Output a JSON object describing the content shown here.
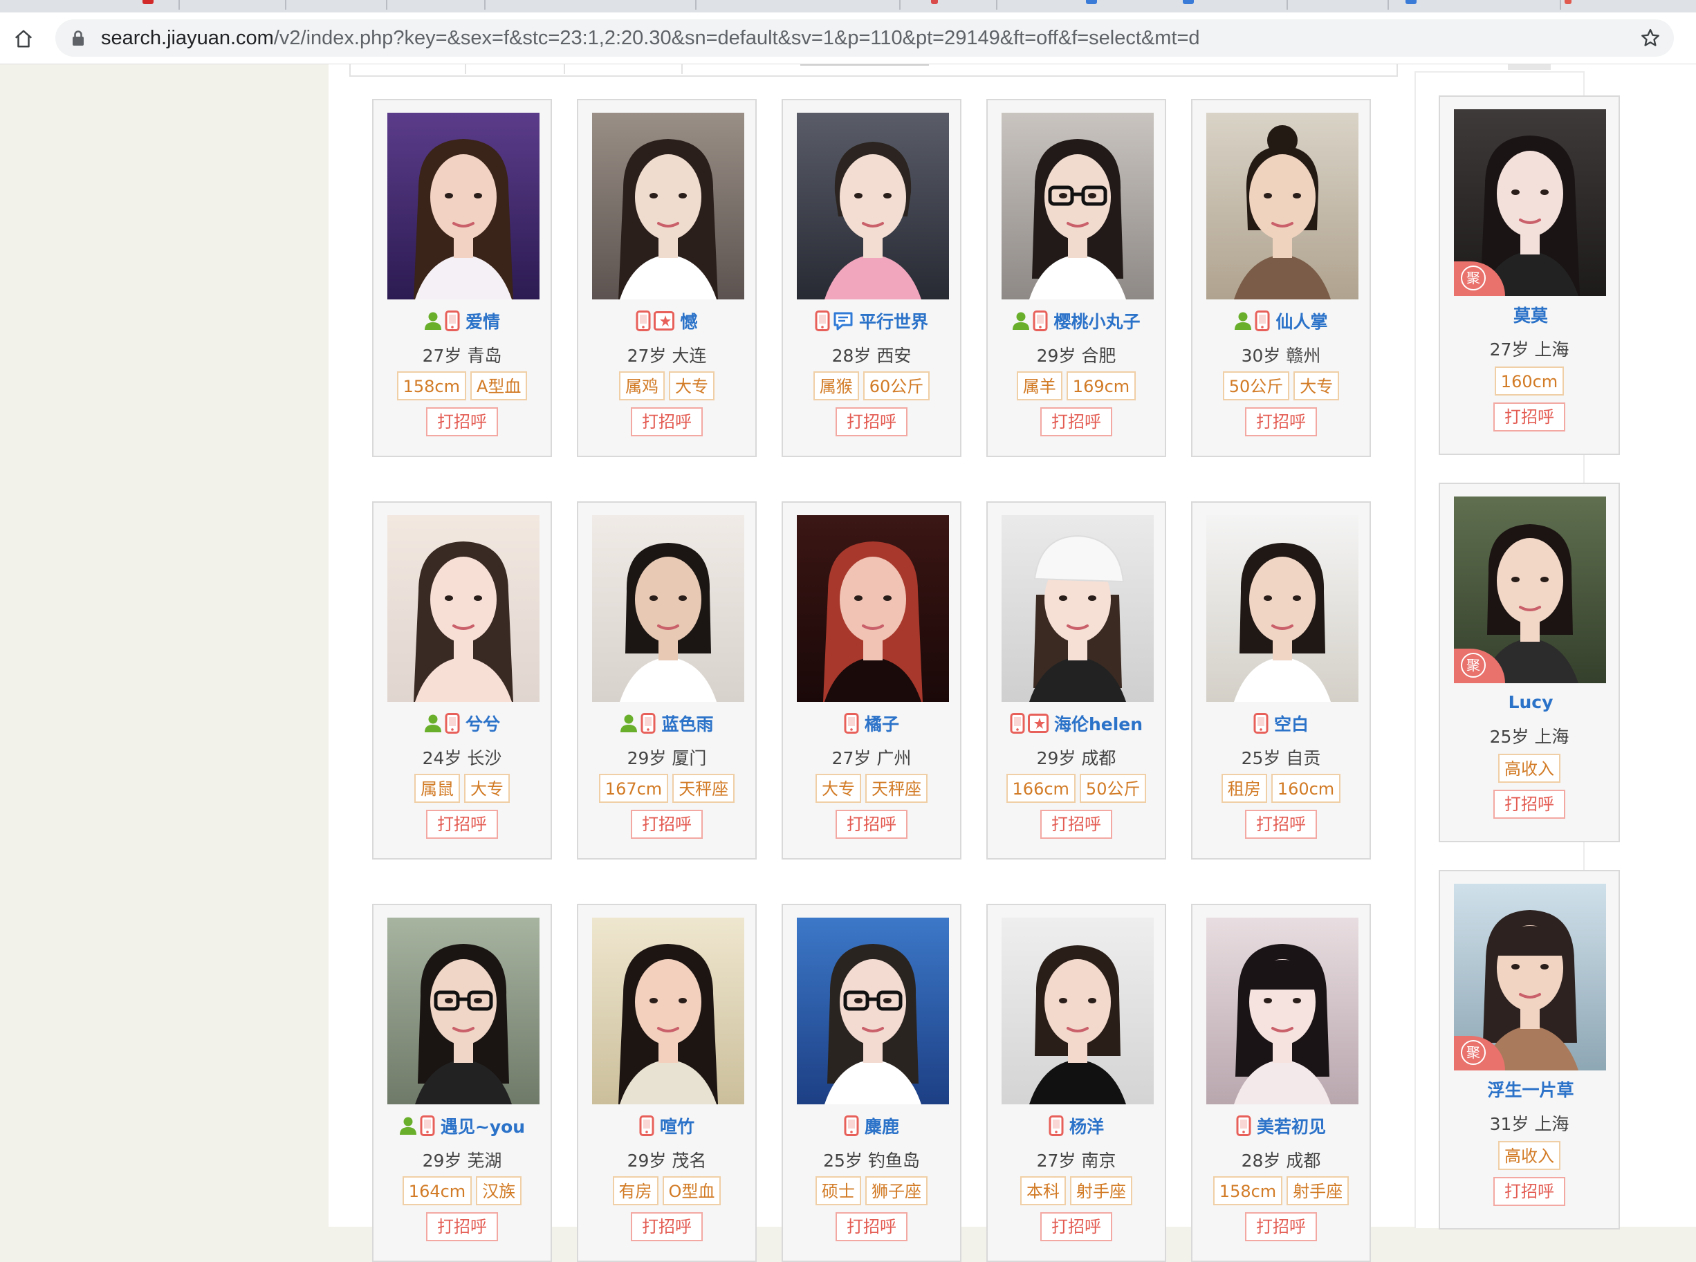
{
  "browser": {
    "url_host": "search.jiayuan.com",
    "url_path": "/v2/index.php?key=&sex=f&stc=23:1,2:20.30&sn=default&sv=1&p=110&pt=29149&ft=off&f=select&mt=d"
  },
  "greet_label": "打招呼",
  "side_badge_text": "聚",
  "profiles": [
    {
      "nickname": "爱情",
      "age_city": "27岁 青岛",
      "tags": [
        "158cm",
        "A型血"
      ],
      "icons": [
        "verified-person",
        "mobile"
      ]
    },
    {
      "nickname": "憾",
      "age_city": "27岁 大连",
      "tags": [
        "属鸡",
        "大专"
      ],
      "icons": [
        "mobile",
        "vip-star"
      ]
    },
    {
      "nickname": "平行世界",
      "age_city": "28岁 西安",
      "tags": [
        "属猴",
        "60公斤"
      ],
      "icons": [
        "mobile",
        "message"
      ]
    },
    {
      "nickname": "樱桃小丸子",
      "age_city": "29岁 合肥",
      "tags": [
        "属羊",
        "169cm"
      ],
      "icons": [
        "verified-person",
        "mobile"
      ]
    },
    {
      "nickname": "仙人掌",
      "age_city": "30岁 赣州",
      "tags": [
        "50公斤",
        "大专"
      ],
      "icons": [
        "verified-person",
        "mobile"
      ]
    },
    {
      "nickname": "兮兮",
      "age_city": "24岁 长沙",
      "tags": [
        "属鼠",
        "大专"
      ],
      "icons": [
        "verified-person",
        "mobile"
      ]
    },
    {
      "nickname": "蓝色雨",
      "age_city": "29岁 厦门",
      "tags": [
        "167cm",
        "天秤座"
      ],
      "icons": [
        "verified-person",
        "mobile"
      ]
    },
    {
      "nickname": "橘子",
      "age_city": "27岁 广州",
      "tags": [
        "大专",
        "天秤座"
      ],
      "icons": [
        "mobile"
      ]
    },
    {
      "nickname": "海伦helen",
      "age_city": "29岁 成都",
      "tags": [
        "166cm",
        "50公斤"
      ],
      "icons": [
        "mobile",
        "vip-star"
      ]
    },
    {
      "nickname": "空白",
      "age_city": "25岁 自贡",
      "tags": [
        "租房",
        "160cm"
      ],
      "icons": [
        "mobile"
      ]
    },
    {
      "nickname": "遇见~you",
      "age_city": "29岁 芜湖",
      "tags": [
        "164cm",
        "汉族"
      ],
      "icons": [
        "verified-person",
        "mobile"
      ]
    },
    {
      "nickname": "喧竹",
      "age_city": "29岁 茂名",
      "tags": [
        "有房",
        "O型血"
      ],
      "icons": [
        "mobile"
      ]
    },
    {
      "nickname": "麋鹿",
      "age_city": "25岁 钓鱼岛",
      "tags": [
        "硕士",
        "狮子座"
      ],
      "icons": [
        "mobile"
      ]
    },
    {
      "nickname": "杨洋",
      "age_city": "27岁 南京",
      "tags": [
        "本科",
        "射手座"
      ],
      "icons": [
        "mobile"
      ]
    },
    {
      "nickname": "美若初见",
      "age_city": "28岁 成都",
      "tags": [
        "158cm",
        "射手座"
      ],
      "icons": [
        "mobile"
      ]
    }
  ],
  "side_profiles": [
    {
      "nickname": "莫莫",
      "age_city": "27岁 上海",
      "tags": [
        "160cm"
      ]
    },
    {
      "nickname": "Lucy",
      "age_city": "25岁 上海",
      "tags": [
        "高收入"
      ]
    },
    {
      "nickname": "浮生一片草",
      "age_city": "31岁 上海",
      "tags": [
        "高收入"
      ]
    }
  ],
  "colors": {
    "accent_blue": "#2b72c9",
    "greet_red": "#e35b52",
    "tag_orange": "#d27b26",
    "verified_green": "#6aaf2c",
    "mobile_red": "#e8605a",
    "message_blue": "#2f7ad6",
    "badge_red": "#e9726d"
  }
}
